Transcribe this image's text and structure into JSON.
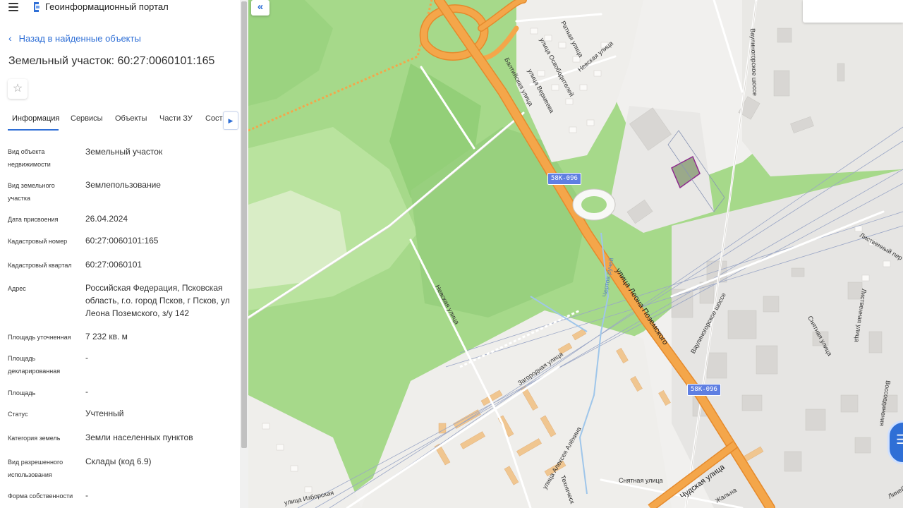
{
  "header": {
    "portal_title": "Геоинформационный портал",
    "menu_icon": "hamburger-menu-icon",
    "logo_icon": "portal-logo-icon"
  },
  "panel": {
    "back_label": "Назад в найденные объекты",
    "object_title": "Земельный участок: 60:27:0060101:165",
    "favorite_icon": "star-outline-icon",
    "tabs": [
      {
        "label": "Информация",
        "active": true
      },
      {
        "label": "Сервисы"
      },
      {
        "label": "Объекты"
      },
      {
        "label": "Части ЗУ"
      },
      {
        "label": "Соста"
      }
    ],
    "tabs_next_icon": "chevron-right-icon",
    "attributes": [
      {
        "label": "Вид объекта недвижимости",
        "value": "Земельный участок"
      },
      {
        "label": "Вид земельного участка",
        "value": "Землепользование"
      },
      {
        "label": "Дата присвоения",
        "value": "26.04.2024"
      },
      {
        "label": "Кадастровый номер",
        "value": "60:27:0060101:165"
      },
      {
        "label": "Кадастровый квартал",
        "value": "60:27:0060101"
      },
      {
        "label": "Адрес",
        "value": "Российская Федерация, Псковская область, г.о. город Псков, г Псков, ул Леона Поземского, з/у 142"
      },
      {
        "label": "Площадь уточненная",
        "value": "7 232 кв. м"
      },
      {
        "label": "Площадь декларированная",
        "value": "-"
      },
      {
        "label": "Площадь",
        "value": "-"
      },
      {
        "label": "Статус",
        "value": "Учтенный"
      },
      {
        "label": "Категория земель",
        "value": "Земли населенных пунктов"
      },
      {
        "label": "Вид разрешенного использования",
        "value": "Склады (код 6.9)"
      },
      {
        "label": "Форма собственности",
        "value": "-"
      }
    ]
  },
  "map": {
    "collapse_icon": "double-chevron-left-icon",
    "collapse_label": "«",
    "road_badges": [
      "58К-096",
      "58К-096"
    ],
    "streets": {
      "poz": "улица Леона Поземского",
      "vaul1": "Ваулиногорское шоссе",
      "vaul2": "Ваулиногорское шоссе",
      "nevskaya1": "Невская улица",
      "nevskaya2": "Невская улица",
      "ratnaya": "Ратная улица",
      "osvob": "улица Освободителей",
      "baltiyskaya": "Балтийская улица",
      "vermeeva": "улица Вермеева",
      "zagorodnaya": "Загородная улица",
      "chudskaya": "Чудская улица",
      "snyatnaya1": "Снятная улица",
      "snyatnaya2": "Снятная улица",
      "alekhina": "улица Алексея Алёхина",
      "izborskaya": "улица Изборская",
      "tekhnich": "Техническ",
      "listvennaya1": "Лиственный пер",
      "listvennaya2": "Лиственная улица",
      "vossoed": "Воссоединения",
      "lineynaya": "Линейная",
      "chertov": "Чертов ручей",
      "zhalna": "Жальна"
    },
    "colors": {
      "forest": "#a6d98a",
      "forest_light": "#c9e9b6",
      "meadow": "#d9edc6",
      "highway": "#f4a64a",
      "highway_border": "#e58a2c",
      "building": "#d8d6d3",
      "building_res": "#f0c690",
      "parcel": "#8e2a8e",
      "accent": "#2f6fd6",
      "badge": "#5f7fe2"
    },
    "chat_icon": "chat-bubble-icon",
    "chat_label": "☰"
  }
}
